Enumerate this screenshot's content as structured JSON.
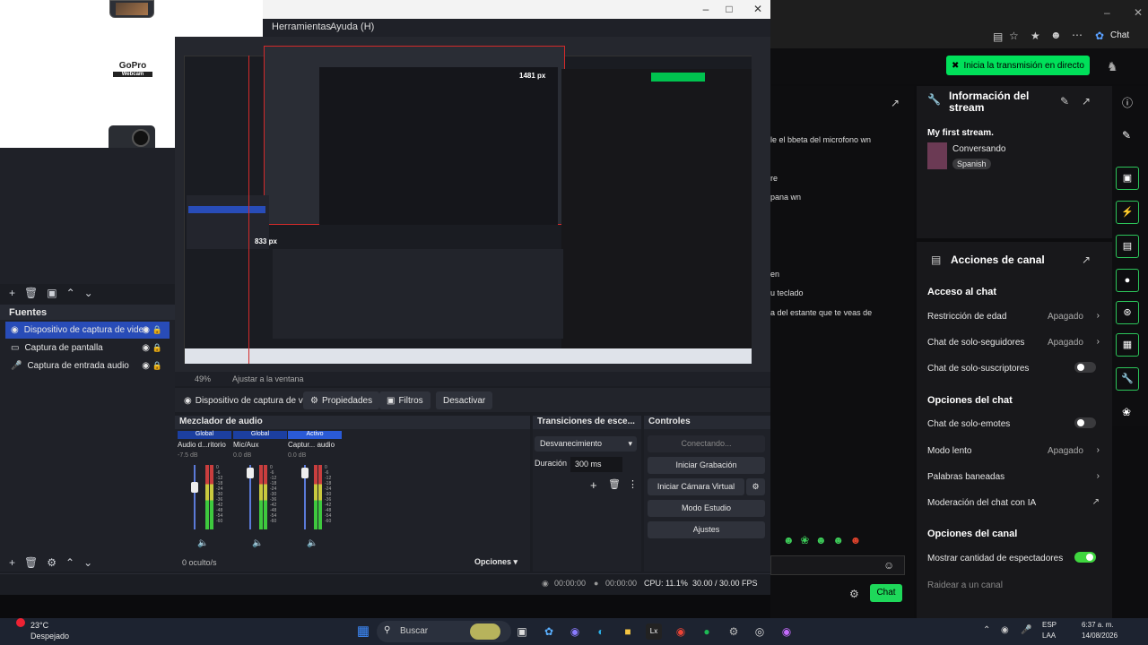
{
  "obs": {
    "menu": [
      "Herramientas",
      "Ayuda (H)"
    ],
    "webcam_logo": "GoPro",
    "webcam_logo_sub": "Webcam",
    "sources_header": "Fuentes",
    "sources": [
      {
        "label": "Dispositivo de captura de video",
        "icon": "camera-icon",
        "selected": true
      },
      {
        "label": "Captura de pantalla",
        "icon": "monitor-icon",
        "selected": false
      },
      {
        "label": "Captura de entrada audio",
        "icon": "mic-icon",
        "selected": false
      }
    ],
    "preview_zoom": "49%",
    "preview_fit": "Ajustar a la ventana",
    "props_bar": {
      "source_name": "Dispositivo de captura de v",
      "properties": "Propiedades",
      "filters": "Filtros",
      "deactivate": "Desactivar"
    },
    "mixer": {
      "title": "Mezclador de audio",
      "channels": [
        {
          "tag": "Global",
          "name": "Audio d...ritorio",
          "db": "-7.5 dB",
          "level": 0.45
        },
        {
          "tag": "Global",
          "name": "Mic/Aux",
          "db": "0.0 dB",
          "level": 0.7
        },
        {
          "tag": "Activo",
          "name": "Captur... audio",
          "db": "0.0 dB",
          "level": 0.55
        }
      ],
      "ticks": [
        "0",
        "-6",
        "-12",
        "-18",
        "-24",
        "-30",
        "-36",
        "-42",
        "-48",
        "-54",
        "-60"
      ],
      "hidden": "0 oculto/s",
      "options": "Opciones"
    },
    "transitions": {
      "title": "Transiciones de esce...",
      "selected": "Desvanecimiento",
      "duration_label": "Duración",
      "duration_value": "300 ms"
    },
    "controls": {
      "title": "Controles",
      "connecting": "Conectando...",
      "start_recording": "Iniciar Grabación",
      "start_virtual_cam": "Iniciar Cámara Virtual",
      "studio_mode": "Modo Estudio",
      "settings": "Ajustes"
    },
    "status": {
      "stream_time": "00:00:00",
      "rec_time": "00:00:00",
      "cpu": "CPU: 11.1%",
      "fps": "30.00 / 30.00 FPS"
    },
    "nested_text": {
      "px_top": "1481 px",
      "px_left": "833 px"
    }
  },
  "browser": {
    "chat_tab": "Chat",
    "live_button": "Inicia la transmisión en directo",
    "stream_info": {
      "title": "Información del stream",
      "stream_name": "My first stream.",
      "category": "Conversando",
      "language": "Spanish"
    },
    "channel_actions": {
      "title": "Acciones de canal",
      "chat_access": "Acceso al chat",
      "rows1": [
        {
          "label": "Restricción de edad",
          "value": "Apagado",
          "type": "chevron"
        },
        {
          "label": "Chat de solo-seguidores",
          "value": "Apagado",
          "type": "chevron"
        },
        {
          "label": "Chat de solo-suscriptores",
          "value": "",
          "type": "toggle-off"
        }
      ],
      "chat_options": "Opciones del chat",
      "rows2": [
        {
          "label": "Chat de solo-emotes",
          "value": "",
          "type": "toggle-off"
        },
        {
          "label": "Modo lento",
          "value": "Apagado",
          "type": "chevron"
        },
        {
          "label": "Palabras baneadas",
          "value": "",
          "type": "chevron"
        },
        {
          "label": "Moderación del chat con IA",
          "value": "",
          "type": "external"
        }
      ],
      "channel_options": "Opciones del canal",
      "rows3": [
        {
          "label": "Mostrar cantidad de espectadores",
          "value": "",
          "type": "toggle-on"
        },
        {
          "label": "Raidear a un canal",
          "value": "",
          "type": "dim"
        }
      ]
    },
    "chat_lines": [
      "le el bbeta del microfono wn",
      "re",
      "pana wn",
      "en",
      "u teclado",
      "a del estante que te veas de"
    ],
    "chat_button": "Chat"
  },
  "taskbar": {
    "weather_temp": "23°C",
    "weather_desc": "Despejado",
    "search_placeholder": "Buscar",
    "lang": "ESP",
    "lang_sub": "LAA",
    "time": "6:37 a. m.",
    "date": "14/08/2026"
  }
}
